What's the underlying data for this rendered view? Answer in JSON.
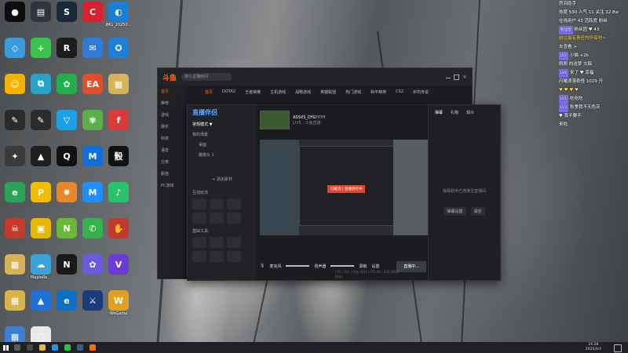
{
  "desktop": {
    "icons": [
      {
        "label": "",
        "color": "#0d0d0f",
        "glyph": "●"
      },
      {
        "label": "",
        "color": "#2f3640",
        "glyph": "▤"
      },
      {
        "label": "",
        "color": "#1b2838",
        "glyph": "S"
      },
      {
        "label": "",
        "color": "#d9202e",
        "glyph": "C"
      },
      {
        "label": "IMG_20250...",
        "color": "#1a7fd4",
        "glyph": "◐"
      },
      {
        "label": "",
        "color": "#3a9bdc",
        "glyph": "◇"
      },
      {
        "label": "",
        "color": "#3ec24e",
        "glyph": "+"
      },
      {
        "label": "",
        "color": "#1d1d1d",
        "glyph": "R"
      },
      {
        "label": "",
        "color": "#2d7bd6",
        "glyph": "✉"
      },
      {
        "label": "",
        "color": "#1e7fd8",
        "glyph": "✪"
      },
      {
        "label": "",
        "color": "#f2b400",
        "glyph": "☺"
      },
      {
        "label": "",
        "color": "#27a3c9",
        "glyph": "⧉"
      },
      {
        "label": "",
        "color": "#23b04c",
        "glyph": "✿"
      },
      {
        "label": "",
        "color": "#e04f2c",
        "glyph": "EA"
      },
      {
        "label": "",
        "color": "#d8b257",
        "glyph": "▦"
      },
      {
        "label": "",
        "color": "#2a2a2a",
        "glyph": "✎"
      },
      {
        "label": "",
        "color": "#2c2c2c",
        "glyph": "✎"
      },
      {
        "label": "",
        "color": "#1aa1e8",
        "glyph": "▽"
      },
      {
        "label": "",
        "color": "#5bb04d",
        "glyph": "✾"
      },
      {
        "label": "",
        "color": "#d93b3b",
        "glyph": "f"
      },
      {
        "label": "",
        "color": "#3a3a3a",
        "glyph": "✦"
      },
      {
        "label": "",
        "color": "#1f1f1f",
        "glyph": "▲"
      },
      {
        "label": "",
        "color": "#111",
        "glyph": "Q"
      },
      {
        "label": "",
        "color": "#0e6fd8",
        "glyph": "M"
      },
      {
        "label": "",
        "color": "#111",
        "glyph": "骰"
      },
      {
        "label": "",
        "color": "#2ba45a",
        "glyph": "e"
      },
      {
        "label": "",
        "color": "#f0c000",
        "glyph": "P"
      },
      {
        "label": "",
        "color": "#e58a2c",
        "glyph": "✸"
      },
      {
        "label": "",
        "color": "#1e8fff",
        "glyph": "M"
      },
      {
        "label": "",
        "color": "#2bc26e",
        "glyph": "♪"
      },
      {
        "label": "",
        "color": "#c43a2a",
        "glyph": "☠"
      },
      {
        "label": "",
        "color": "#e8b800",
        "glyph": "▣"
      },
      {
        "label": "",
        "color": "#68b934",
        "glyph": "N"
      },
      {
        "label": "",
        "color": "#36b24a",
        "glyph": "✆"
      },
      {
        "label": "",
        "color": "#c0392b",
        "glyph": "✋"
      },
      {
        "label": "",
        "color": "#d8b257",
        "glyph": "▦"
      },
      {
        "label": "MapleRe...",
        "color": "#3aa4d8",
        "glyph": "☁"
      },
      {
        "label": "",
        "color": "#1a1a1a",
        "glyph": "N"
      },
      {
        "label": "",
        "color": "#6a5ae0",
        "glyph": "✿"
      },
      {
        "label": "",
        "color": "#6c3bd6",
        "glyph": "V"
      },
      {
        "label": "",
        "color": "#d9b44a",
        "glyph": "▦"
      },
      {
        "label": "",
        "color": "#1e6fd6",
        "glyph": "▲"
      },
      {
        "label": "",
        "color": "#0f6fc6",
        "glyph": "e"
      },
      {
        "label": "",
        "color": "#1a3c7a",
        "glyph": "⚔"
      },
      {
        "label": "WeGame",
        "color": "#e0a020",
        "glyph": "W"
      },
      {
        "label": "",
        "color": "#3a7fd4",
        "glyph": "▦"
      },
      {
        "label": "",
        "color": "#e8e8e8",
        "glyph": "□"
      }
    ]
  },
  "douyu": {
    "logo": "斗鱼",
    "search_placeholder": "搜小主播房间",
    "nav": [
      "首页",
      "DOTA2",
      "王者荣耀",
      "主机游戏",
      "战略游戏",
      "英雄联盟",
      "热门游戏",
      "和平精英",
      "CS2",
      "炉石传说"
    ],
    "side": [
      "首页",
      "推荐",
      "游戏",
      "娱乐",
      "科技",
      "语音",
      "分类",
      "颜值",
      "PC游戏"
    ]
  },
  "livetool": {
    "brand": "直播伴侣",
    "mode": "常规模式 ▼",
    "scene_header": "我的场景",
    "scenes": [
      "桌面",
      "摄像头 1"
    ],
    "add_source": "+ 添加素材",
    "section_interact": "互动玩法",
    "section_tools": "基础工具",
    "stream_title": "ASSVS_DYG!!!!!!",
    "stream_sub": "LIVE · 斗鱼直播",
    "preview_popup": "已推流 | 直播进行中",
    "ctrl_left": "麦克风",
    "ctrl_mid": "扬声器",
    "ctrl_right": "录制",
    "ctrl_right2": "设置",
    "go_live": "直播中...",
    "tabs": [
      "弹幕",
      "礼物",
      "观众"
    ],
    "right_msg": "弹幕助手已连接至直播间",
    "right_btn1": "弹幕设置",
    "right_btn2": "清空",
    "status": "CPU 23%  |  内存 41%  |  FPS 60  |  码率 6000 kbps"
  },
  "danmaku": {
    "lines": [
      {
        "text": "房间助手",
        "hl": false,
        "badge": ""
      },
      {
        "text": "热度 530 人气 11 关注 32.8w",
        "hl": false,
        "badge": ""
      },
      {
        "text": "在线用户 43 活跃度 粉丝",
        "hl": false,
        "badge": ""
      },
      {
        "text": "粉丝团 ♥ 43",
        "hl": false,
        "badge": "粉丝团"
      },
      {
        "text": "前往最有责任的伴侣吧~",
        "hl": true,
        "badge": ""
      },
      {
        "text": "去查看 >",
        "hl": false,
        "badge": ""
      },
      {
        "text": "小猫 +2k",
        "hl": false,
        "badge": "LV2"
      },
      {
        "text": "刚刚 的送梦 文稿",
        "hl": false,
        "badge": ""
      },
      {
        "text": "来了 ♥ 幸福",
        "hl": false,
        "badge": "LV4"
      },
      {
        "text": "闪耀滴落奇怪 1029 开",
        "hl": false,
        "badge": ""
      },
      {
        "text": "♥ ♥ ♥ ♥",
        "hl": true,
        "badge": ""
      },
      {
        "text": "吃吃吃",
        "hl": false,
        "badge": "LV1"
      },
      {
        "text": "秋季我不天色灰",
        "hl": false,
        "badge": "LV3"
      },
      {
        "text": "♥ 我不要不",
        "hl": false,
        "badge": ""
      },
      {
        "text": "来啦",
        "hl": false,
        "badge": ""
      }
    ]
  },
  "taskbar": {
    "time": "16:28",
    "date": "2025/4/3",
    "apps": [
      {
        "name": "search",
        "color": "#5a5a5a"
      },
      {
        "name": "task-view",
        "color": "#4a4a4a"
      },
      {
        "name": "file-explorer",
        "color": "#e6b84a"
      },
      {
        "name": "edge",
        "color": "#2a8fe0"
      },
      {
        "name": "wechat",
        "color": "#2bc24a"
      },
      {
        "name": "steam",
        "color": "#3a5f8f"
      },
      {
        "name": "douyu",
        "color": "#ff6a13"
      }
    ]
  }
}
